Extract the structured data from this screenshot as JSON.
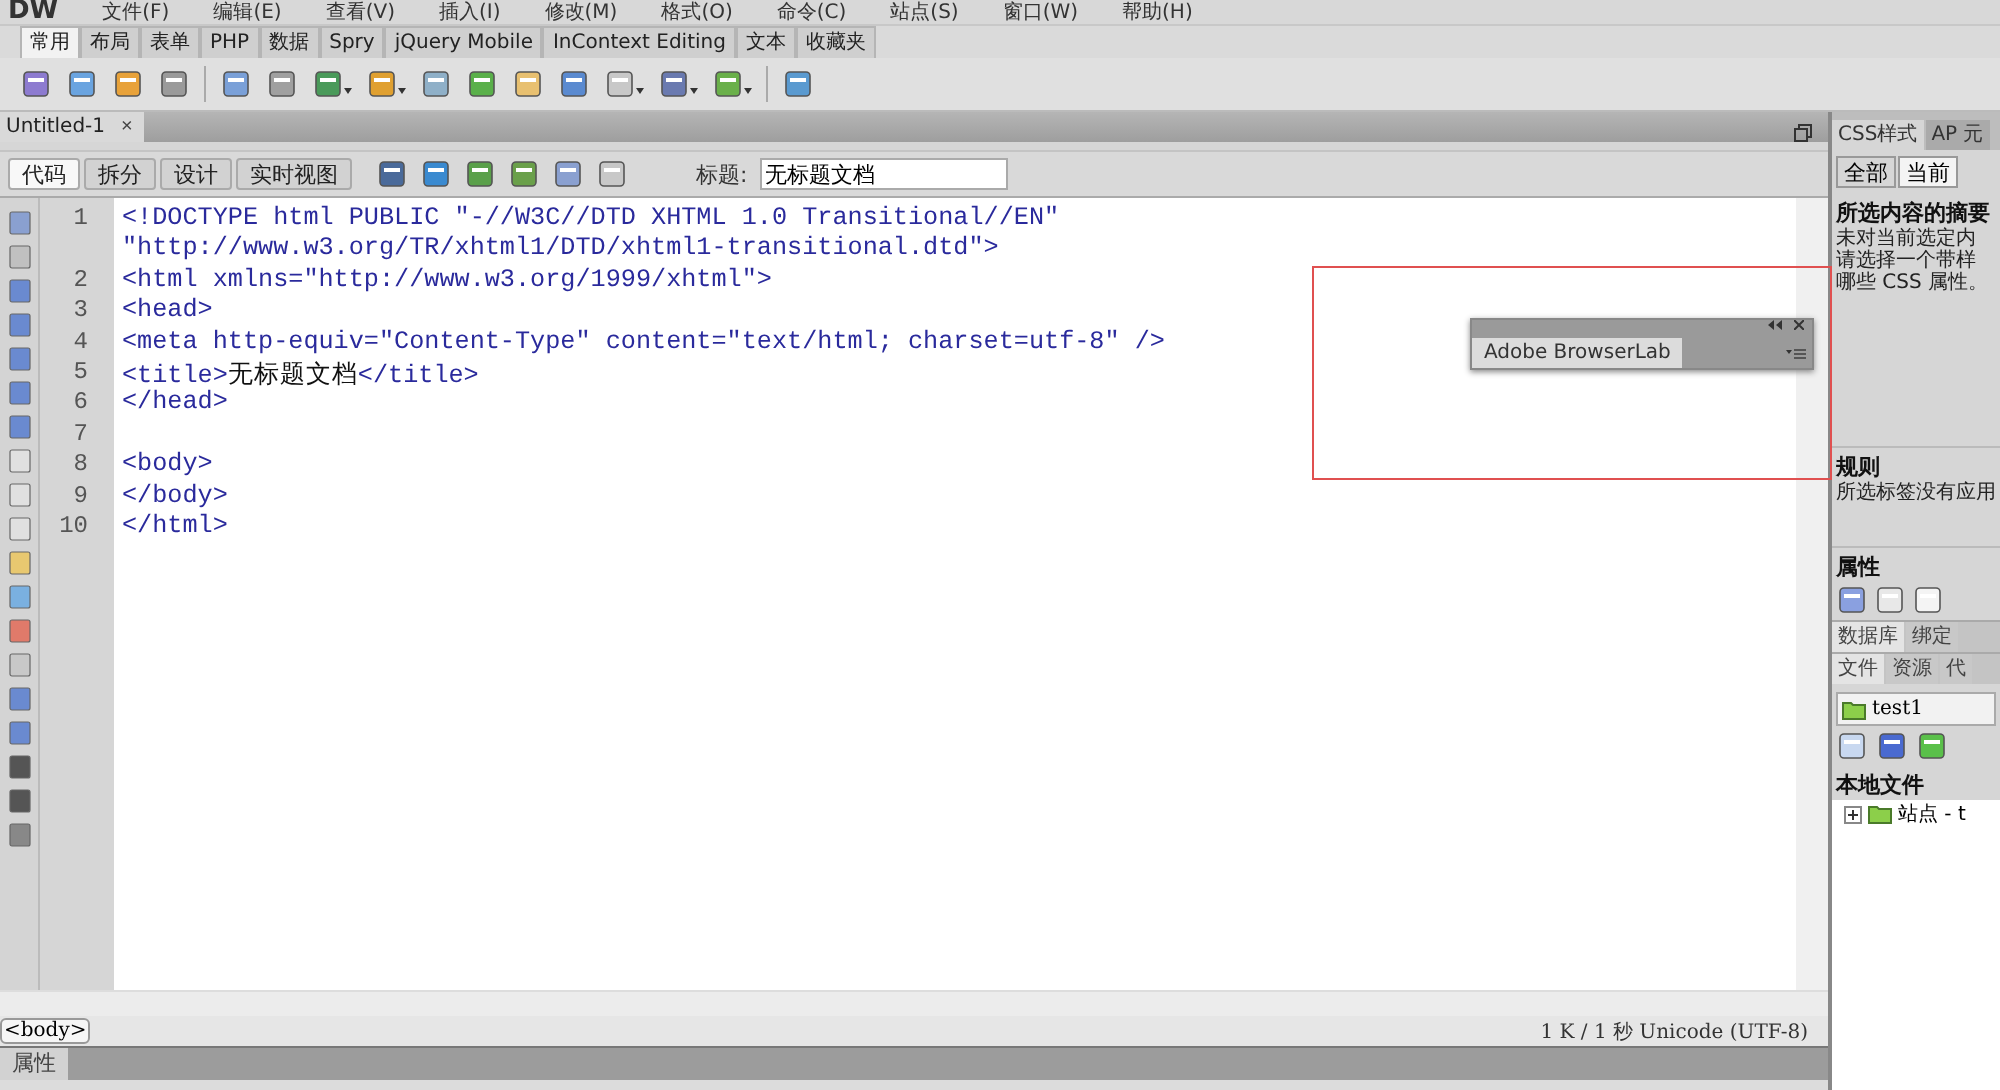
{
  "menu_bar": {
    "logo": "DW",
    "items": [
      "文件(F)",
      "编辑(E)",
      "查看(V)",
      "插入(I)",
      "修改(M)",
      "格式(O)",
      "命令(C)",
      "站点(S)",
      "窗口(W)",
      "帮助(H)"
    ]
  },
  "insert_bar": {
    "tabs": [
      {
        "label": "常用",
        "selected": true
      },
      {
        "label": "布局",
        "selected": false
      },
      {
        "label": "表单",
        "selected": false
      },
      {
        "label": "PHP",
        "selected": false
      },
      {
        "label": "数据",
        "selected": false
      },
      {
        "label": "Spry",
        "selected": false
      },
      {
        "label": "jQuery Mobile",
        "selected": false
      },
      {
        "label": "InContext Editing",
        "selected": false
      },
      {
        "label": "文本",
        "selected": false
      },
      {
        "label": "收藏夹",
        "selected": false
      }
    ]
  },
  "document_tab": {
    "title": "Untitled-1",
    "close": "×"
  },
  "document_toolbar": {
    "views": [
      {
        "label": "代码",
        "selected": true
      },
      {
        "label": "拆分",
        "selected": false
      },
      {
        "label": "设计",
        "selected": false
      },
      {
        "label": "实时视图",
        "selected": false
      }
    ],
    "title_label": "标题:",
    "title_value": "无标题文档"
  },
  "code_lines": [
    {
      "number": "1",
      "segments": [
        {
          "kind": "tag",
          "text": "<!DOCTYPE html PUBLIC \"-//W3C//DTD XHTML 1.0 Transitional//EN\""
        }
      ]
    },
    {
      "segments": [
        {
          "kind": "tag",
          "text": "\"http://www.w3.org/TR/xhtml1/DTD/xhtml1-transitional.dtd\">"
        }
      ]
    },
    {
      "number": "2",
      "segments": [
        {
          "kind": "tag",
          "text": "<html xmlns=\"http://www.w3.org/1999/xhtml\">"
        }
      ]
    },
    {
      "number": "3",
      "segments": [
        {
          "kind": "tag",
          "text": "<head>"
        }
      ]
    },
    {
      "number": "4",
      "segments": [
        {
          "kind": "tag",
          "text": "<meta http-equiv=\"Content-Type\" content=\"text/html; charset=utf-8\" />"
        }
      ]
    },
    {
      "number": "5",
      "segments": [
        {
          "kind": "tag",
          "text": "<title>"
        },
        {
          "kind": "text",
          "text": "无标题文档"
        },
        {
          "kind": "tag",
          "text": "</title>"
        }
      ]
    },
    {
      "number": "6",
      "segments": [
        {
          "kind": "tag",
          "text": "</head>"
        }
      ]
    },
    {
      "number": "7"
    },
    {
      "number": "8",
      "segments": [
        {
          "kind": "tag",
          "text": "<body>"
        }
      ]
    },
    {
      "number": "9",
      "segments": [
        {
          "kind": "tag",
          "text": "</body>"
        }
      ]
    },
    {
      "number": "10",
      "segments": [
        {
          "kind": "tag",
          "text": "</html>"
        }
      ]
    }
  ],
  "status_bar": {
    "tag": "<body>",
    "info": "1 K / 1 秒 Unicode (UTF-8)"
  },
  "properties_panel": {
    "title": "属性"
  },
  "right_panel": {
    "tabs": [
      {
        "label": "CSS样式",
        "selected": true
      },
      {
        "label": "AP 元",
        "selected": false
      }
    ],
    "mode_buttons": [
      {
        "label": "全部",
        "selected": false
      },
      {
        "label": "当前",
        "selected": true
      }
    ],
    "summary": {
      "heading": "所选内容的摘要",
      "lines": [
        "未对当前选定内",
        "请选择一个带样",
        "哪些 CSS 属性。"
      ]
    },
    "rules": {
      "heading": "规则",
      "text": "所选标签没有应用"
    },
    "properties": {
      "heading": "属性"
    },
    "data_tabs": [
      {
        "label": "数据库",
        "selected": true
      },
      {
        "label": "绑定",
        "selected": false
      }
    ],
    "file_tabs": [
      {
        "label": "文件",
        "selected": true
      },
      {
        "label": "资源",
        "selected": false
      },
      {
        "label": "代",
        "selected": false
      }
    ],
    "site": "test1",
    "local_files": {
      "heading": "本地文件",
      "items": [
        {
          "label": "站点 - t",
          "expanded": false
        }
      ]
    }
  },
  "floating_panel": {
    "title": "Adobe BrowserLab"
  }
}
